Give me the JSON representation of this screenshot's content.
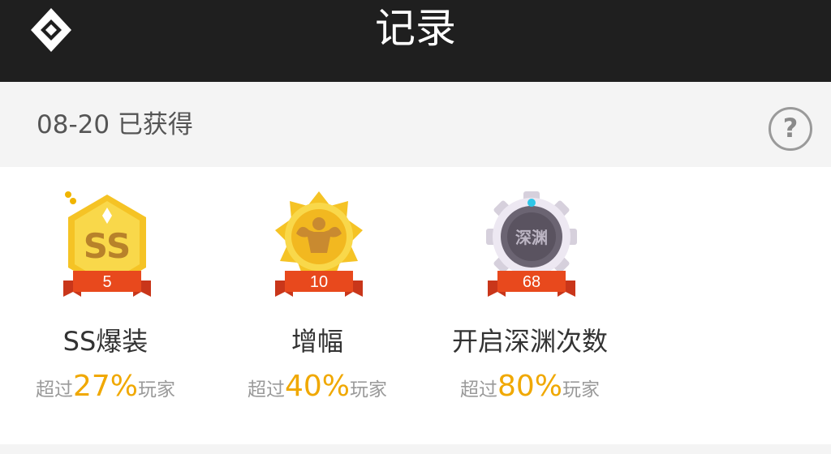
{
  "header": {
    "title": "记录",
    "logo_icon": "diamond-logo-icon"
  },
  "subbar": {
    "date_text": "08-20 已获得",
    "help_icon": "question-circle-icon",
    "help_glyph": "?"
  },
  "badges": [
    {
      "icon": "ss-shield-badge-icon",
      "emblem": "SS",
      "count": "5",
      "name": "SS爆装",
      "stat_prefix": "超过",
      "stat_percent": "27%",
      "stat_suffix": "玩家"
    },
    {
      "icon": "muscle-sun-badge-icon",
      "count": "10",
      "name": "增幅",
      "stat_prefix": "超过",
      "stat_percent": "40%",
      "stat_suffix": "玩家"
    },
    {
      "icon": "gear-abyss-badge-icon",
      "emblem": "深渊",
      "count": "68",
      "name": "开启深渊次数",
      "stat_prefix": "超过",
      "stat_percent": "80%",
      "stat_suffix": "玩家"
    }
  ],
  "colors": {
    "header_bg": "#1f1f1f",
    "subbar_bg": "#f4f4f4",
    "percent": "#f0a800",
    "ribbon": "#e8491d",
    "gold": "#f5c325"
  }
}
